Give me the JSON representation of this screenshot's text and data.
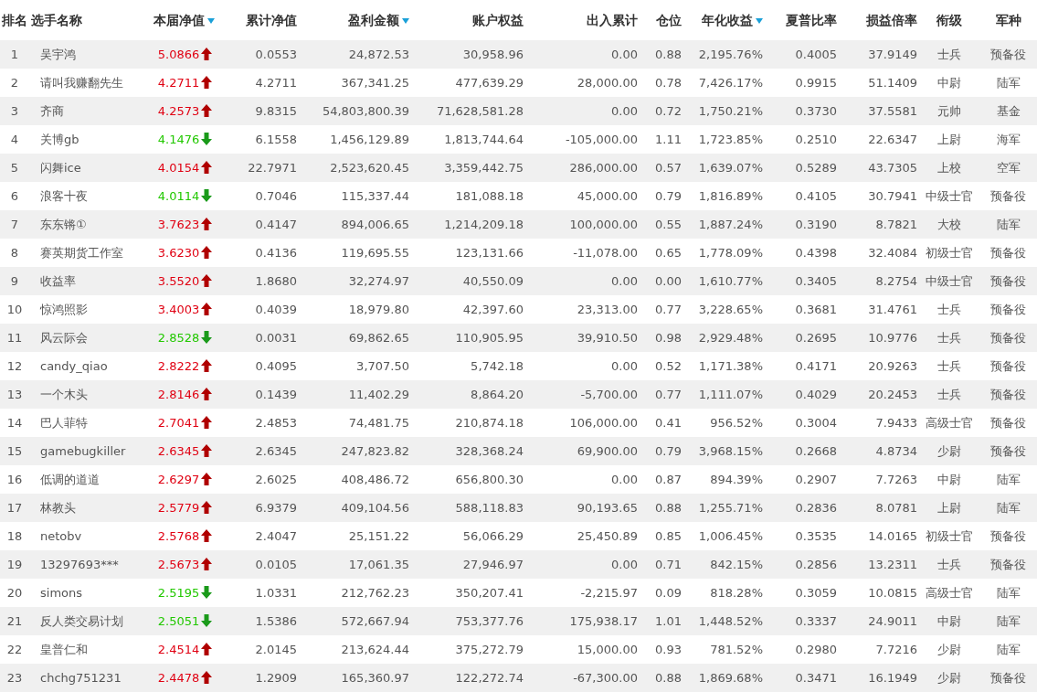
{
  "table": {
    "columns": [
      {
        "label": "排名",
        "sort_indicator": false
      },
      {
        "label": "选手名称",
        "sort_indicator": false
      },
      {
        "label": "本届净值",
        "sort_indicator": true
      },
      {
        "label": "累计净值",
        "sort_indicator": false
      },
      {
        "label": "盈利金额",
        "sort_indicator": true
      },
      {
        "label": "账户权益",
        "sort_indicator": false
      },
      {
        "label": "出入累计",
        "sort_indicator": false
      },
      {
        "label": "仓位",
        "sort_indicator": false
      },
      {
        "label": "年化收益",
        "sort_indicator": true
      },
      {
        "label": "夏普比率",
        "sort_indicator": false
      },
      {
        "label": "损益倍率",
        "sort_indicator": false
      },
      {
        "label": "衔级",
        "sort_indicator": false
      },
      {
        "label": "军种",
        "sort_indicator": false
      }
    ],
    "rows": [
      {
        "rising": true,
        "cells": [
          "1",
          "吴宇鸿",
          "5.0866",
          "0.0553",
          "24,872.53",
          "30,958.96",
          "0.00",
          "0.88",
          "2,195.76%",
          "0.4005",
          "37.9149",
          "士兵",
          "预备役"
        ]
      },
      {
        "rising": true,
        "cells": [
          "2",
          "请叫我赚翻先生",
          "4.2711",
          "4.2711",
          "367,341.25",
          "477,639.29",
          "28,000.00",
          "0.78",
          "7,426.17%",
          "0.9915",
          "51.1409",
          "中尉",
          "陆军"
        ]
      },
      {
        "rising": true,
        "cells": [
          "3",
          "齐商",
          "4.2573",
          "9.8315",
          "54,803,800.39",
          "71,628,581.28",
          "0.00",
          "0.72",
          "1,750.21%",
          "0.3730",
          "37.5581",
          "元帅",
          "基金"
        ]
      },
      {
        "rising": false,
        "cells": [
          "4",
          "关博gb",
          "4.1476",
          "6.1558",
          "1,456,129.89",
          "1,813,744.64",
          "-105,000.00",
          "1.11",
          "1,723.85%",
          "0.2510",
          "22.6347",
          "上尉",
          "海军"
        ]
      },
      {
        "rising": true,
        "cells": [
          "5",
          "闪舞ice",
          "4.0154",
          "22.7971",
          "2,523,620.45",
          "3,359,442.75",
          "286,000.00",
          "0.57",
          "1,639.07%",
          "0.5289",
          "43.7305",
          "上校",
          "空军"
        ]
      },
      {
        "rising": false,
        "cells": [
          "6",
          "浪客十夜",
          "4.0114",
          "0.7046",
          "115,337.44",
          "181,088.18",
          "45,000.00",
          "0.79",
          "1,816.89%",
          "0.4105",
          "30.7941",
          "中级士官",
          "预备役"
        ]
      },
      {
        "rising": true,
        "cells": [
          "7",
          "东东锵①",
          "3.7623",
          "0.4147",
          "894,006.65",
          "1,214,209.18",
          "100,000.00",
          "0.55",
          "1,887.24%",
          "0.3190",
          "8.7821",
          "大校",
          "陆军"
        ]
      },
      {
        "rising": true,
        "cells": [
          "8",
          "赛英期货工作室",
          "3.6230",
          "0.4136",
          "119,695.55",
          "123,131.66",
          "-11,078.00",
          "0.65",
          "1,778.09%",
          "0.4398",
          "32.4084",
          "初级士官",
          "预备役"
        ]
      },
      {
        "rising": true,
        "cells": [
          "9",
          "收益率",
          "3.5520",
          "1.8680",
          "32,274.97",
          "40,550.09",
          "0.00",
          "0.00",
          "1,610.77%",
          "0.3405",
          "8.2754",
          "中级士官",
          "预备役"
        ]
      },
      {
        "rising": true,
        "cells": [
          "10",
          "惊鸿照影",
          "3.4003",
          "0.4039",
          "18,979.80",
          "42,397.60",
          "23,313.00",
          "0.77",
          "3,228.65%",
          "0.3681",
          "31.4761",
          "士兵",
          "预备役"
        ]
      },
      {
        "rising": false,
        "cells": [
          "11",
          "风云际会",
          "2.8528",
          "0.0031",
          "69,862.65",
          "110,905.95",
          "39,910.50",
          "0.98",
          "2,929.48%",
          "0.2695",
          "10.9776",
          "士兵",
          "预备役"
        ]
      },
      {
        "rising": true,
        "cells": [
          "12",
          "candy_qiao",
          "2.8222",
          "0.4095",
          "3,707.50",
          "5,742.18",
          "0.00",
          "0.52",
          "1,171.38%",
          "0.4171",
          "20.9263",
          "士兵",
          "预备役"
        ]
      },
      {
        "rising": true,
        "cells": [
          "13",
          "一个木头",
          "2.8146",
          "0.1439",
          "11,402.29",
          "8,864.20",
          "-5,700.00",
          "0.77",
          "1,111.07%",
          "0.4029",
          "20.2453",
          "士兵",
          "预备役"
        ]
      },
      {
        "rising": true,
        "cells": [
          "14",
          "巴人菲特",
          "2.7041",
          "2.4853",
          "74,481.75",
          "210,874.18",
          "106,000.00",
          "0.41",
          "956.52%",
          "0.3004",
          "7.9433",
          "高级士官",
          "预备役"
        ]
      },
      {
        "rising": true,
        "cells": [
          "15",
          "gamebugkiller",
          "2.6345",
          "2.6345",
          "247,823.82",
          "328,368.24",
          "69,900.00",
          "0.79",
          "3,968.15%",
          "0.2668",
          "4.8734",
          "少尉",
          "预备役"
        ]
      },
      {
        "rising": true,
        "cells": [
          "16",
          "低调的道道",
          "2.6297",
          "2.6025",
          "408,486.72",
          "656,800.30",
          "0.00",
          "0.87",
          "894.39%",
          "0.2907",
          "7.7263",
          "中尉",
          "陆军"
        ]
      },
      {
        "rising": true,
        "cells": [
          "17",
          "林教头",
          "2.5779",
          "6.9379",
          "409,104.56",
          "588,118.83",
          "90,193.65",
          "0.88",
          "1,255.71%",
          "0.2836",
          "8.0781",
          "上尉",
          "陆军"
        ]
      },
      {
        "rising": true,
        "cells": [
          "18",
          "netobv",
          "2.5768",
          "2.4047",
          "25,151.22",
          "56,066.29",
          "25,450.89",
          "0.85",
          "1,006.45%",
          "0.3535",
          "14.0165",
          "初级士官",
          "预备役"
        ]
      },
      {
        "rising": true,
        "cells": [
          "19",
          "13297693***",
          "2.5673",
          "0.0105",
          "17,061.35",
          "27,946.97",
          "0.00",
          "0.71",
          "842.15%",
          "0.2856",
          "13.2311",
          "士兵",
          "预备役"
        ]
      },
      {
        "rising": false,
        "cells": [
          "20",
          "simons",
          "2.5195",
          "1.0331",
          "212,762.23",
          "350,207.41",
          "-2,215.97",
          "0.09",
          "818.28%",
          "0.3059",
          "10.0815",
          "高级士官",
          "陆军"
        ]
      },
      {
        "rising": false,
        "cells": [
          "21",
          "反人类交易计划",
          "2.5051",
          "1.5386",
          "572,667.94",
          "753,377.76",
          "175,938.17",
          "1.01",
          "1,448.52%",
          "0.3337",
          "24.9011",
          "中尉",
          "陆军"
        ]
      },
      {
        "rising": true,
        "cells": [
          "22",
          "皇普仁和",
          "2.4514",
          "2.0145",
          "213,624.44",
          "375,272.79",
          "15,000.00",
          "0.93",
          "781.52%",
          "0.2980",
          "7.7216",
          "少尉",
          "陆军"
        ]
      },
      {
        "rising": true,
        "cells": [
          "23",
          "chchg751231",
          "2.4478",
          "1.2909",
          "165,360.97",
          "122,272.74",
          "-67,300.00",
          "0.88",
          "1,869.68%",
          "0.3471",
          "16.1949",
          "少尉",
          "预备役"
        ]
      }
    ]
  }
}
